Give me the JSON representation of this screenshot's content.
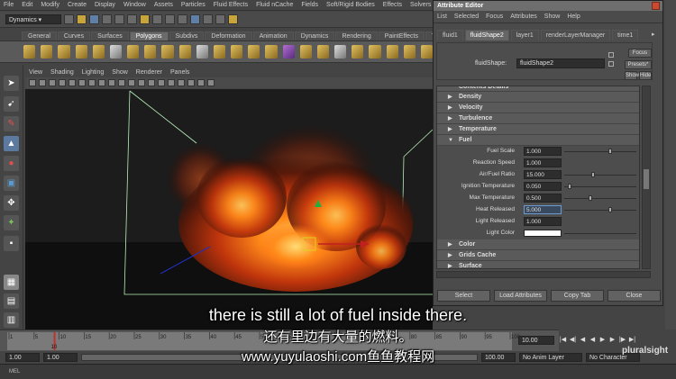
{
  "main_menu": [
    "File",
    "Edit",
    "Modify",
    "Create",
    "Display",
    "Window",
    "Assets",
    "Particles",
    "Fluid Effects",
    "Fluid nCache",
    "Fields",
    "Soft/Rigid Bodies",
    "Effects",
    "Solvers",
    "Pipeline Cache"
  ],
  "status_line": {
    "menu_set": "Dynamics"
  },
  "shelf_tabs": [
    "General",
    "Curves",
    "Surfaces",
    "Polygons",
    "Subdivs",
    "Deformation",
    "Animation",
    "Dynamics",
    "Rendering",
    "PaintEffects",
    "Toon",
    "Muscle"
  ],
  "active_shelf_tab": "Polygons",
  "viewport_menu": [
    "View",
    "Shading",
    "Lighting",
    "Show",
    "Renderer",
    "Panels"
  ],
  "subtitles": {
    "line1": "there is still a lot of fuel inside there.",
    "line2": "还有里边有大量的燃料。",
    "line3": "www.yuyulaoshi.com鱼鱼教程网"
  },
  "attribute_editor": {
    "title": "Attribute Editor",
    "menu": [
      "List",
      "Selected",
      "Focus",
      "Attributes",
      "Show",
      "Help"
    ],
    "tabs": [
      "fluid1",
      "fluidShape2",
      "layer1",
      "renderLayerManager",
      "time1"
    ],
    "active_tab": "fluidShape2",
    "shape_label": "fluidShape:",
    "shape_value": "fluidShape2",
    "focus_label": "Focus",
    "presets_label": "Presets*",
    "show_label": "Show",
    "hide_label": "Hide",
    "sections_top": [
      {
        "label": "Contents Details",
        "expanded": true
      },
      {
        "label": "Density",
        "expanded": false
      },
      {
        "label": "Velocity",
        "expanded": false
      },
      {
        "label": "Turbulence",
        "expanded": false
      },
      {
        "label": "Temperature",
        "expanded": false
      },
      {
        "label": "Fuel",
        "expanded": true
      }
    ],
    "fuel_attrs": [
      {
        "label": "Fuel Scale",
        "value": "1.000",
        "slider": 0.65
      },
      {
        "label": "Reaction Speed",
        "value": "1.000",
        "slider": null
      },
      {
        "label": "Air/Fuel Ratio",
        "value": "15.000",
        "slider": 0.4
      },
      {
        "label": "Ignition Temperature",
        "value": "0.050",
        "slider": 0.05
      },
      {
        "label": "Max Temperature",
        "value": "0.500",
        "slider": 0.35
      },
      {
        "label": "Heat Released",
        "value": "5.000",
        "slider": 0.65
      },
      {
        "label": "Light Released",
        "value": "1.000",
        "slider": null
      }
    ],
    "light_color_label": "Light Color",
    "sections_bottom": [
      {
        "label": "Color",
        "expanded": false
      },
      {
        "label": "Grids Cache",
        "expanded": false
      },
      {
        "label": "Surface",
        "expanded": false
      }
    ],
    "buttons": [
      "Select",
      "Load Attributes",
      "Copy Tab",
      "Close"
    ]
  },
  "timeline": {
    "ticks": [
      "1",
      "5",
      "10",
      "15",
      "20",
      "25",
      "30",
      "35",
      "40",
      "45",
      "50",
      "55",
      "60",
      "65",
      "70",
      "75",
      "80",
      "85",
      "90",
      "95",
      "100"
    ],
    "current_frame_marker": "10",
    "current_time": "10.00"
  },
  "range_slider": {
    "start": "1.00",
    "playback_start": "1.00",
    "end": "100.00",
    "anim_layer": "No Anim Layer",
    "character_set": "No Character Set"
  },
  "command_line": "MEL",
  "watermark": "pluralsight"
}
